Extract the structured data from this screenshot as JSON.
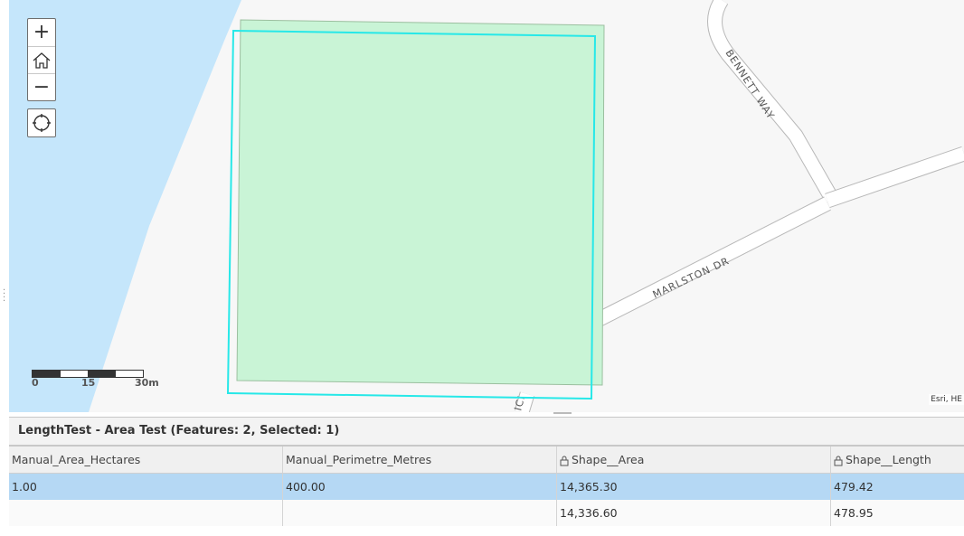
{
  "map": {
    "road_labels": {
      "bennett": "BENNETT WAY",
      "marlston": "MARLSTON DR",
      "partial": "ICI"
    },
    "scalebar": {
      "labels": [
        "0",
        "15",
        "30m"
      ]
    },
    "attribution": "Esri, HE",
    "controls": {
      "zoom_in": "+",
      "zoom_out": "−"
    },
    "colors": {
      "water": "#c5e6fb",
      "land": "#f7f7f7",
      "feature_fill": "#c9f4d6",
      "selection_outline": "#27e8e8"
    }
  },
  "table": {
    "title": "LengthTest - Area Test (Features: 2, Selected: 1)",
    "columns": [
      {
        "label": "Manual_Area_Hectares",
        "locked": false
      },
      {
        "label": "Manual_Perimetre_Metres",
        "locked": false
      },
      {
        "label": "Shape__Area",
        "locked": true
      },
      {
        "label": "Shape__Length",
        "locked": true
      }
    ],
    "rows": [
      {
        "selected": true,
        "cells": [
          "1.00",
          "400.00",
          "14,365.30",
          "479.42"
        ]
      },
      {
        "selected": false,
        "cells": [
          "",
          "",
          "14,336.60",
          "478.95"
        ]
      }
    ]
  }
}
